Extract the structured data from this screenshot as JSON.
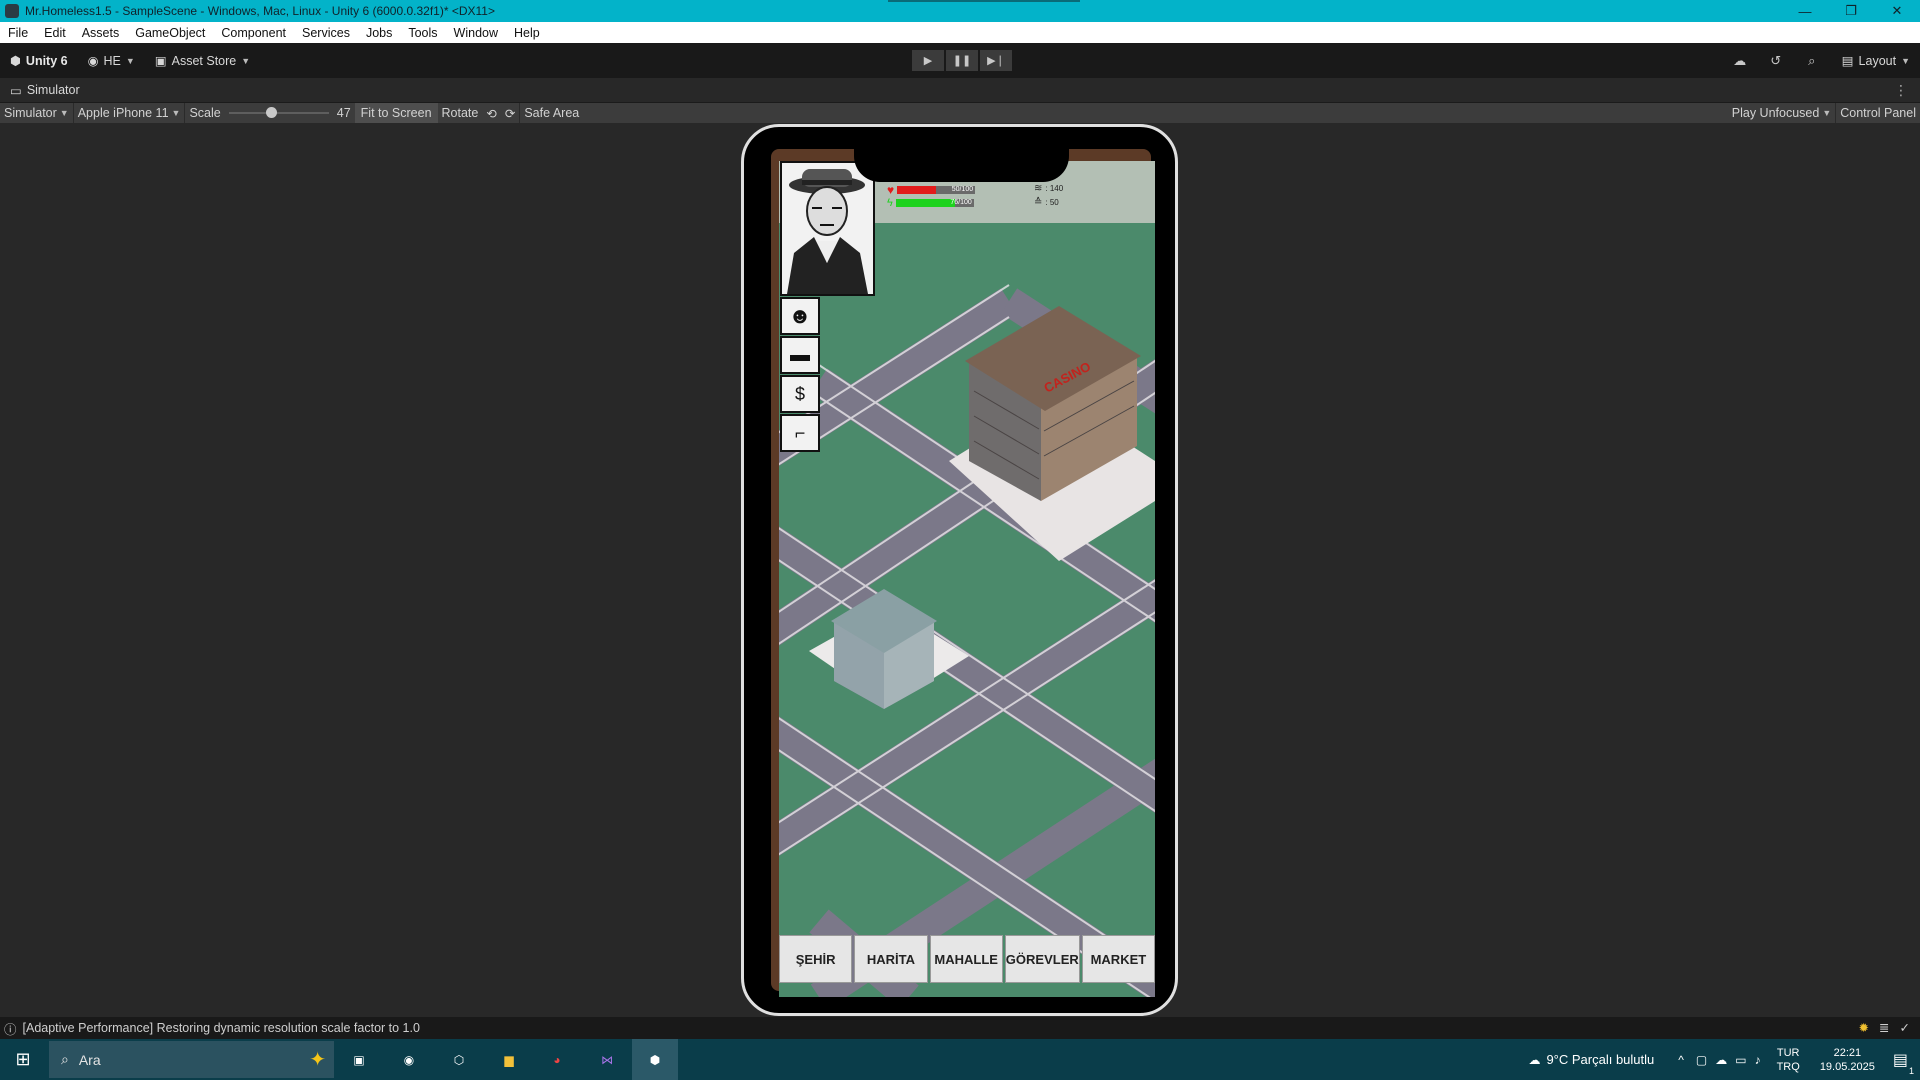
{
  "window": {
    "title": "Mr.Homeless1.5 - SampleScene - Windows, Mac, Linux - Unity 6 (6000.0.32f1)* <DX11>",
    "controls": {
      "minimize": "—",
      "restore": "❐",
      "close": "✕"
    }
  },
  "menu": [
    "File",
    "Edit",
    "Assets",
    "GameObject",
    "Component",
    "Services",
    "Jobs",
    "Tools",
    "Window",
    "Help"
  ],
  "toolbar": {
    "unity_label": "Unity 6",
    "account_label": "HE",
    "asset_store_label": "Asset Store",
    "layout_label": "Layout"
  },
  "simulator": {
    "tab_label": "Simulator",
    "mode_label": "Simulator",
    "device_label": "Apple iPhone 11",
    "scale_label": "Scale",
    "scale_value": "47",
    "scale_fraction": 0.42,
    "fit_label": "Fit to Screen",
    "rotate_label": "Rotate",
    "safe_area_label": "Safe Area",
    "play_mode_label": "Play Unfocused",
    "control_panel_label": "Control Panel"
  },
  "game": {
    "health_text": "50/100",
    "health_fraction": 0.5,
    "health_color": "#e21b1b",
    "energy_text": "76/100",
    "energy_fraction": 0.76,
    "energy_color": "#1ed21e",
    "stat1_text": ": 140",
    "stat2_text": ": 50",
    "casino_sign": "CASINO",
    "nav": [
      "ŞEHİR",
      "HARİTA",
      "MAHALLE",
      "GÖREVLER",
      "MARKET"
    ]
  },
  "status": {
    "message": "[Adaptive Performance] Restoring dynamic resolution scale factor to 1.0"
  },
  "taskbar": {
    "search_placeholder": "Ara",
    "weather": "9°C  Parçalı bulutlu",
    "lang_top": "TUR",
    "lang_bottom": "TRQ",
    "time": "22:21",
    "date": "19.05.2025",
    "notification_count": "1"
  }
}
